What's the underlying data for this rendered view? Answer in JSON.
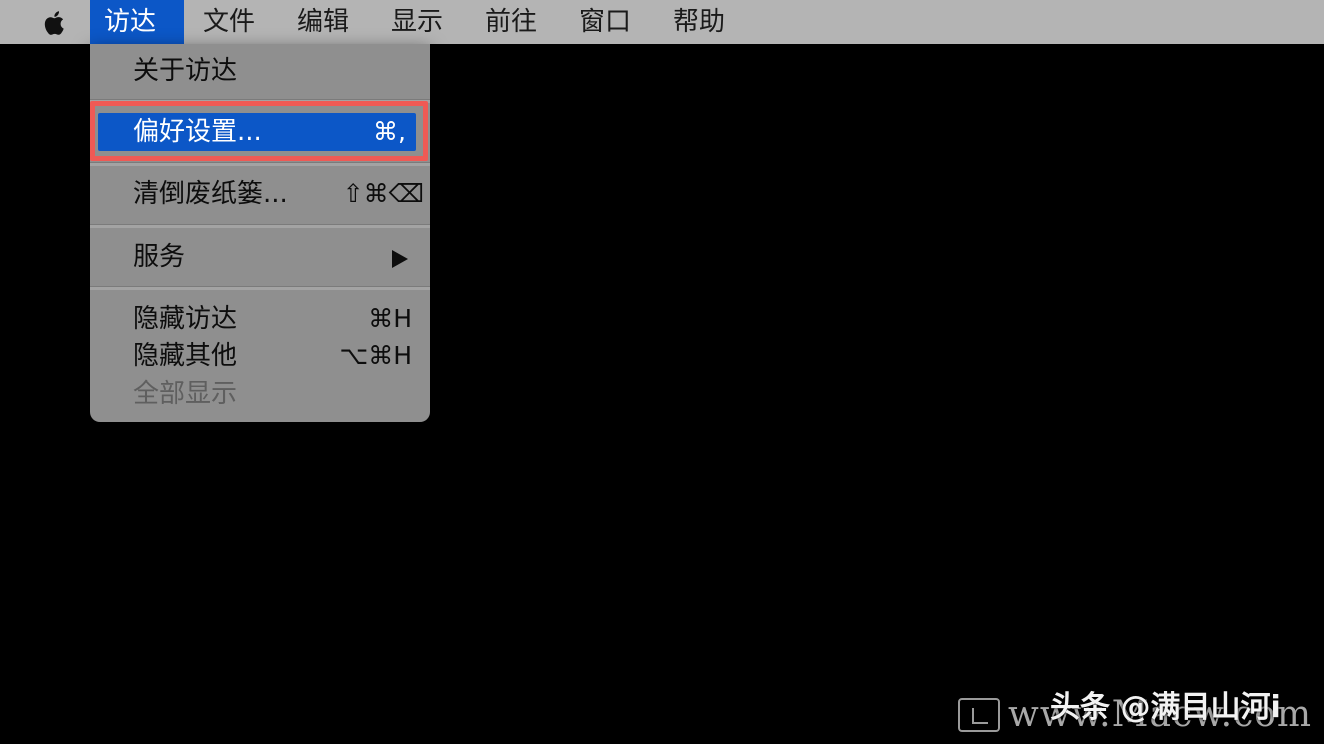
{
  "menubar": {
    "apple_icon": "apple-logo-icon",
    "menus": [
      {
        "label": "访达",
        "active": true
      },
      {
        "label": "文件",
        "active": false
      },
      {
        "label": "编辑",
        "active": false
      },
      {
        "label": "显示",
        "active": false
      },
      {
        "label": "前往",
        "active": false
      },
      {
        "label": "窗口",
        "active": false
      },
      {
        "label": "帮助",
        "active": false
      }
    ]
  },
  "dropdown": {
    "about": {
      "label": "关于访达"
    },
    "preferences": {
      "label": "偏好设置...",
      "shortcut": "⌘,"
    },
    "empty_trash": {
      "label": "清倒废纸篓...",
      "shortcut": "⇧⌘⌫"
    },
    "services": {
      "label": "服务"
    },
    "hide_finder": {
      "label": "隐藏访达",
      "shortcut": "⌘H"
    },
    "hide_others": {
      "label": "隐藏其他",
      "shortcut": "⌥⌘H"
    },
    "show_all": {
      "label": "全部显示"
    }
  },
  "watermark": {
    "site": "www.Macw.com",
    "author": "头条 @满目山河i"
  },
  "colors": {
    "menubar_bg": "#b4b4b4",
    "highlight_blue": "#0c57c7",
    "menu_bg": "#8f8f8f",
    "annotation_red": "#ef5a55"
  }
}
